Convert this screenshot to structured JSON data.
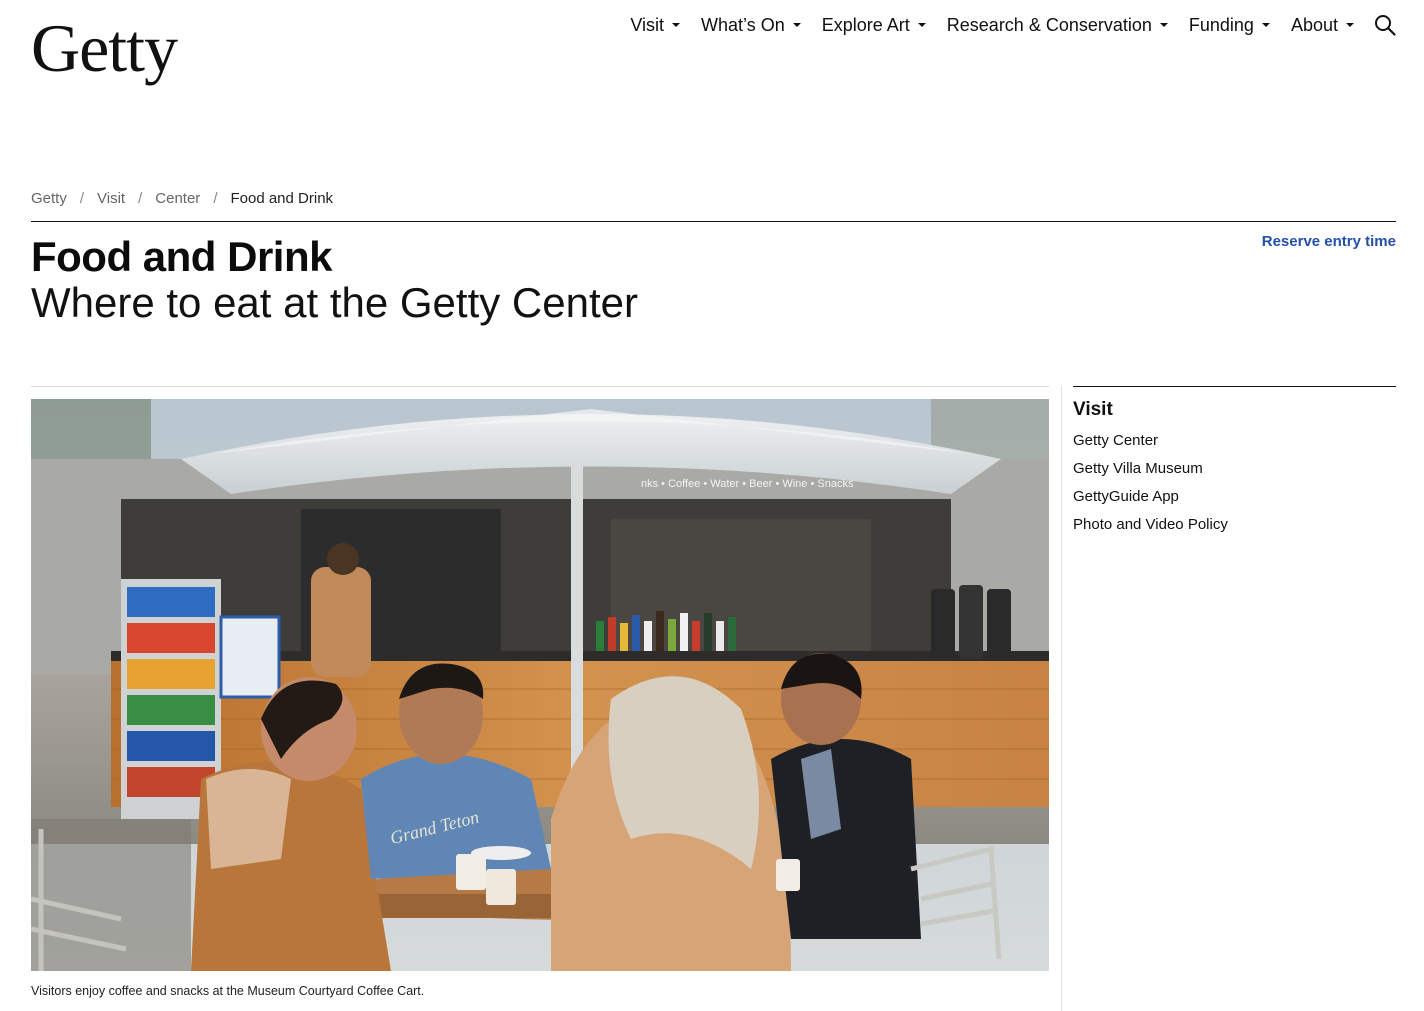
{
  "header": {
    "logo": "Getty",
    "nav": [
      {
        "label": "Visit"
      },
      {
        "label": "What’s On"
      },
      {
        "label": "Explore Art"
      },
      {
        "label": "Research & Conservation"
      },
      {
        "label": "Funding"
      },
      {
        "label": "About"
      }
    ],
    "search_icon": "search-icon"
  },
  "breadcrumb": {
    "items": [
      "Getty",
      "Visit",
      "Center"
    ],
    "current": "Food and Drink",
    "separator": "/"
  },
  "page": {
    "title": "Food and Drink",
    "subtitle": "Where to eat at the Getty Center",
    "reserve_link": "Reserve entry time"
  },
  "hero": {
    "caption": "Visitors enjoy coffee and snacks at the Museum Courtyard Coffee Cart.",
    "cart_sign": "nks • Coffee • Water • Beer • Wine • Snacks",
    "shirt_text": "Grand Teton"
  },
  "sidebar": {
    "heading": "Visit",
    "items": [
      {
        "label": "Getty Center"
      },
      {
        "label": "Getty Villa Museum"
      },
      {
        "label": "GettyGuide App"
      },
      {
        "label": "Photo and Video Policy"
      }
    ]
  },
  "colors": {
    "link_blue": "#2450a8",
    "text": "#111111",
    "rule": "#111111"
  }
}
